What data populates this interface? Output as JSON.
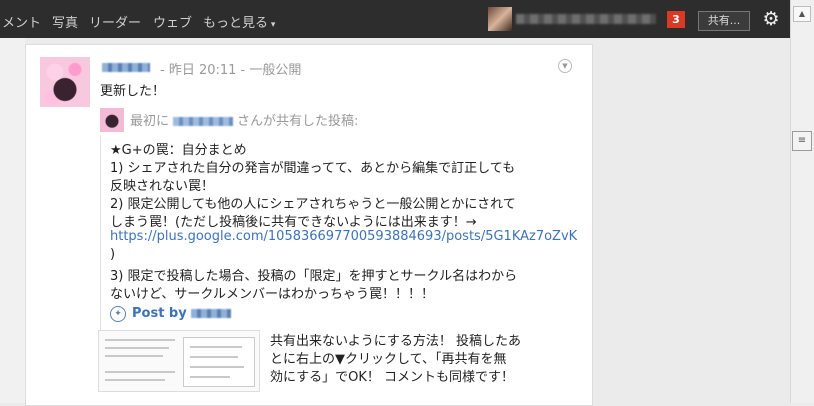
{
  "nav": {
    "items": [
      {
        "label": "メント"
      },
      {
        "label": "写真"
      },
      {
        "label": "リーダー"
      },
      {
        "label": "ウェブ"
      },
      {
        "label": "もっと見る"
      }
    ],
    "notification_count": "3",
    "share_label": "共有...",
    "settings_icon": "gear-icon"
  },
  "post": {
    "meta": "- 昨日 20:11 - 一般公開",
    "text": "更新した！",
    "shared_prefix": "最初に",
    "shared_suffix": "さんが共有した投稿:",
    "quote_lines": [
      "★G+の罠：自分まとめ",
      "1) シェアされた自分の発言が間違ってて、あとから編集で訂正しても",
      "反映されない罠！",
      "2) 限定公開しても他の人にシェアされちゃうと一般公開とかにされて",
      "しまう罠！(ただし投稿後に共有できないようには出来ます！→",
      "https://plus.google.com/105836697700593884693/posts/5G1KAz7oZvK",
      ")",
      "3) 限定で投稿した場合、投稿の「限定」を押すとサークル名はわから",
      "ないけど、サークルメンバーはわかっちゃう罠！！！！"
    ],
    "post_by_label": "Post by",
    "caption_lines": [
      "共有出来ないようにする方法！ 投稿したあ",
      "とに右上の▼クリックして、「再共有を無",
      "効にする」でOK！ コメントも同様です！"
    ]
  },
  "colors": {
    "topbar": "#2d2d2d",
    "notification": "#d93a25",
    "link": "#3d72b8"
  }
}
